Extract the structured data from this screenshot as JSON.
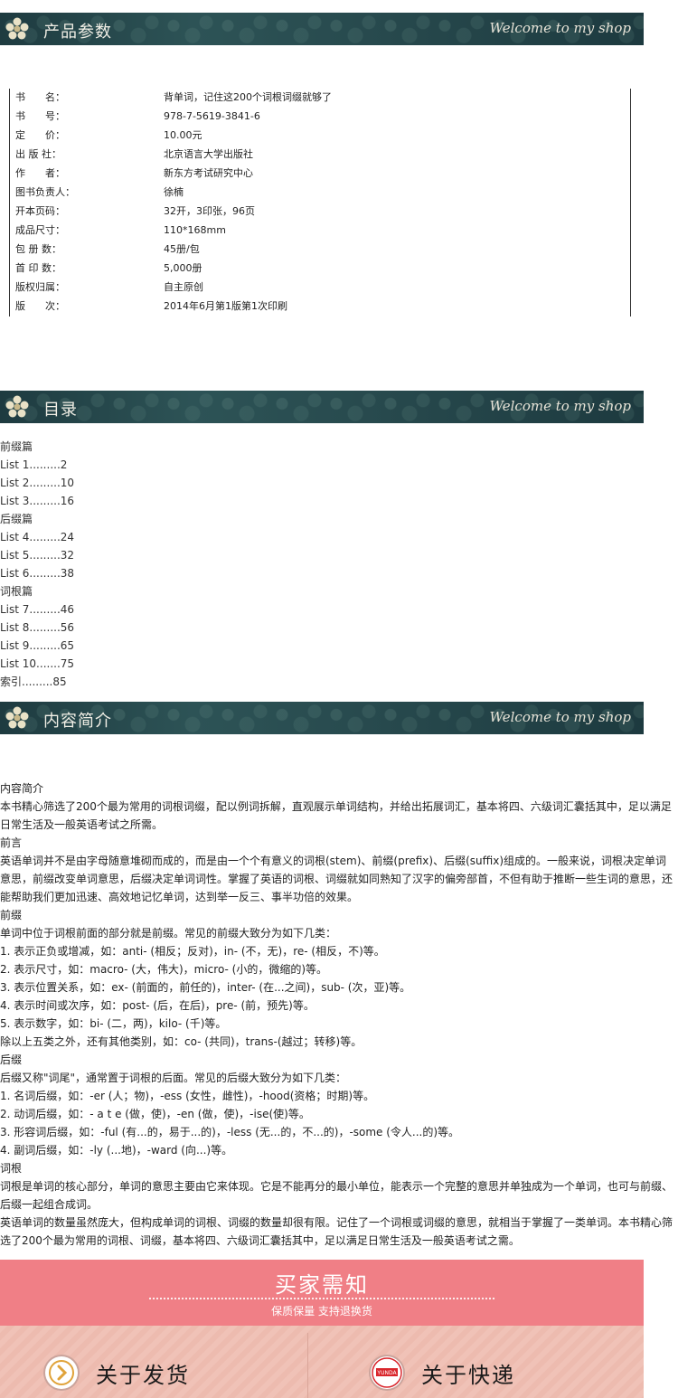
{
  "banners": {
    "welcome": "Welcome to my shop",
    "params_title": "产品参数",
    "toc_title": "目录",
    "intro_title": "内容简介"
  },
  "params": [
    {
      "k": "书　　名：",
      "v": "背单词，记住这200个词根词缀就够了"
    },
    {
      "k": "书　　号：",
      "v": "978-7-5619-3841-6"
    },
    {
      "k": "定　　价：",
      "v": "10.00元"
    },
    {
      "k": "出 版 社：",
      "v": "北京语言大学出版社"
    },
    {
      "k": "作　　者：",
      "v": "新东方考试研究中心"
    },
    {
      "k": "图书负责人：",
      "v": "徐楠"
    },
    {
      "k": "开本页码：",
      "v": "32开，3印张，96页"
    },
    {
      "k": "成品尺寸：",
      "v": "110*168mm"
    },
    {
      "k": "包 册 数：",
      "v": "45册/包"
    },
    {
      "k": "首 印 数：",
      "v": "5,000册"
    },
    {
      "k": "版权归属：",
      "v": "自主原创"
    },
    {
      "k": "版　　次：",
      "v": "2014年6月第1版第1次印刷"
    }
  ],
  "toc": [
    "前缀篇",
    "List 1.........2",
    "List 2.........10",
    "List 3.........16",
    "后缀篇",
    "List 4.........24",
    "List 5.........32",
    "List 6.........38",
    "词根篇",
    "List 7.........46",
    "List 8.........56",
    "List 9.........65",
    "List 10.......75",
    "索引.........85"
  ],
  "intro": [
    "内容简介",
    "本书精心筛选了200个最为常用的词根词缀，配以例词拆解，直观展示单词结构，并给出拓展词汇，基本将四、六级词汇囊括其中，足以满足日常生活及一般英语考试之所需。",
    "前言",
    "英语单词并不是由字母随意堆砌而成的，而是由一个个有意义的词根(stem)、前缀(prefix)、后缀(suffix)组成的。一般来说，词根决定单词意思，前缀改变单词意思，后缀决定单词词性。掌握了英语的词根、词缀就如同熟知了汉字的偏旁部首，不但有助于推断一些生词的意思，还能帮助我们更加迅速、高效地记忆单词，达到举一反三、事半功倍的效果。",
    "前缀",
    "单词中位于词根前面的部分就是前缀。常见的前缀大致分为如下几类：",
    "1. 表示正负或增减，如：anti- (相反；反对)，in- (不，无)，re- (相反，不)等。",
    "2. 表示尺寸，如：macro- (大，伟大)，micro- (小的，微缩的)等。",
    "3. 表示位置关系，如：ex- (前面的，前任的)，inter- (在...之间)，sub- (次，亚)等。",
    "4. 表示时间或次序，如：post- (后，在后)，pre- (前，预先)等。",
    "5. 表示数字，如：bi- (二，两)，kilo- (千)等。",
    "除以上五类之外，还有其他类别，如：co- (共同)，trans-(越过；转移)等。",
    "后缀",
    "后缀又称\"词尾\"，通常置于词根的后面。常见的后缀大致分为如下几类：",
    "1. 名词后缀，如：-er (人；物)，-ess (女性，雌性)，-hood(资格；时期)等。",
    "2. 动词后缀，如：- a t e (做，使)，-en (做，使)，-ise(使)等。",
    "3. 形容词后缀，如：-ful (有...的，易于...的)，-less (无...的，不...的)，-some (令人...的)等。",
    "4. 副词后缀，如：-ly (...地)，-ward (向...)等。",
    "词根",
    "词根是单词的核心部分，单词的意思主要由它来体现。它是不能再分的最小单位，能表示一个完整的意思并单独成为一个单词，也可与前缀、后缀一起组合成词。",
    "英语单词的数量虽然庞大，但构成单词的词根、词缀的数量却很有限。记住了一个词根或词缀的意思，就相当于掌握了一类单词。本书精心筛选了200个最为常用的词根、词缀，基本将四、六级词汇囊括其中，足以满足日常生活及一般英语考试之需。"
  ],
  "notice": {
    "title": "买家需知",
    "subtitle": "保质保量 支持退换货",
    "left": "关于发货",
    "right": "关于快递",
    "express_logo": "YUNDA"
  }
}
